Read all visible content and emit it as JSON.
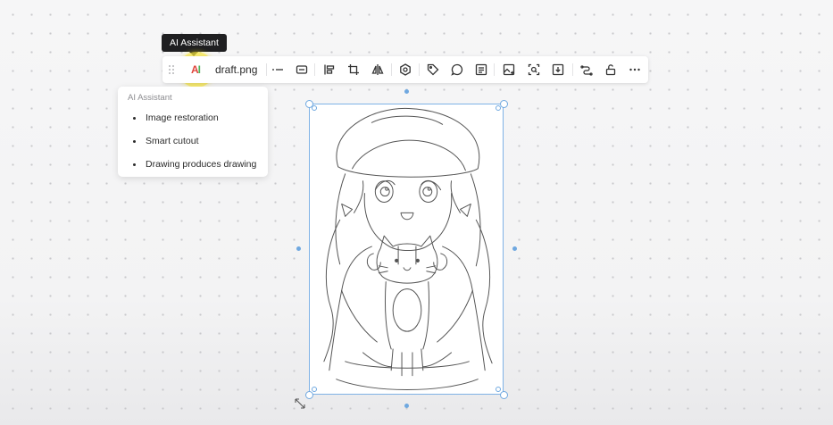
{
  "tooltip": {
    "text": "AI Assistant"
  },
  "toolbar": {
    "ai_logo_a": "A",
    "ai_logo_i": "I",
    "filename": "draft.png"
  },
  "menu": {
    "header": "AI Assistant",
    "items": [
      {
        "label": "Image restoration"
      },
      {
        "label": "Smart cutout"
      },
      {
        "label": "Drawing produces drawing"
      }
    ]
  },
  "icons": [
    "drag-handle-icon",
    "ai-assistant-icon",
    "horizontal-line-icon",
    "border-icon",
    "align-icon",
    "crop-icon",
    "flip-icon",
    "settings-icon",
    "tag-icon",
    "comment-icon",
    "note-icon",
    "replace-image-icon",
    "zoom-image-icon",
    "download-icon",
    "link-icon",
    "unlock-icon",
    "more-icon"
  ],
  "colors": {
    "selection": "#6fa8e0",
    "tooltip_bg": "#1f1f21",
    "highlight": "#fae83c",
    "ai_red": "#e0453c",
    "ai_green": "#4fb35a"
  }
}
